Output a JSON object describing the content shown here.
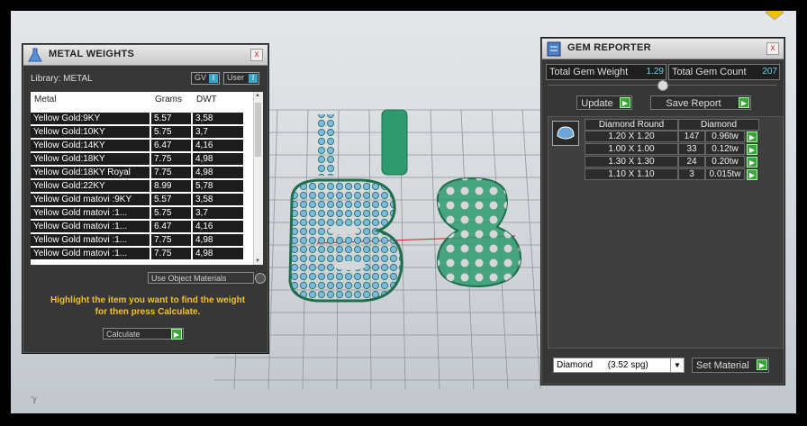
{
  "metal_panel": {
    "title": "METAL WEIGHTS",
    "library_label": "Library: METAL",
    "gv_label": "GV",
    "user_label": "User",
    "toggle_glyph": "I",
    "columns": [
      "Metal",
      "Grams",
      "DWT"
    ],
    "rows": [
      [
        "Yellow Gold:9KY",
        "5.57",
        "3,58"
      ],
      [
        "Yellow Gold:10KY",
        "5.75",
        "3,7"
      ],
      [
        "Yellow Gold:14KY",
        "6.47",
        "4,16"
      ],
      [
        "Yellow Gold:18KY",
        "7.75",
        "4,98"
      ],
      [
        "Yellow Gold:18KY Royal",
        "7.75",
        "4,98"
      ],
      [
        "Yellow Gold:22KY",
        "8.99",
        "5,78"
      ],
      [
        "Yellow Gold matovi :9KY",
        "5.57",
        "3,58"
      ],
      [
        "Yellow Gold matovi :1...",
        "5.75",
        "3,7"
      ],
      [
        "Yellow Gold matovi :1...",
        "6.47",
        "4,16"
      ],
      [
        "Yellow Gold matovi :1...",
        "7.75",
        "4,98"
      ],
      [
        "Yellow Gold matovi :1...",
        "7.75",
        "4,98"
      ]
    ],
    "use_object_materials": "Use Object Materials",
    "hint_line1": "Highlight the item you want to find the weight",
    "hint_line2": "for then press Calculate.",
    "calculate_label": "Calculate"
  },
  "gem_panel": {
    "title": "GEM REPORTER",
    "total_weight_label": "Total Gem Weight",
    "total_weight_value": "1.29",
    "total_count_label": "Total Gem Count",
    "total_count_value": "207",
    "update_label": "Update",
    "save_report_label": "Save Report",
    "headers": [
      "Diamond Round",
      "Diamond"
    ],
    "rows": [
      [
        "1.20 X 1.20",
        "147",
        "0.96tw"
      ],
      [
        "1.00 X 1.00",
        "33",
        "0.12tw"
      ],
      [
        "1.30 X 1.30",
        "24",
        "0.20tw"
      ],
      [
        "1.10 X 1.10",
        "3",
        "0.015tw"
      ]
    ],
    "material_select": "Diamond      (3.52 spg)",
    "set_material_label": "Set Material"
  },
  "icons": {
    "arrow": "▶",
    "dropdown": "▼",
    "close": "x"
  },
  "colors": {
    "accent_green": "#3da33d",
    "hint_yellow": "#f0c030",
    "value_cyan": "#6cd0e8",
    "model_green": "#2f9a6e",
    "gem_blue": "#6aa7d8"
  }
}
